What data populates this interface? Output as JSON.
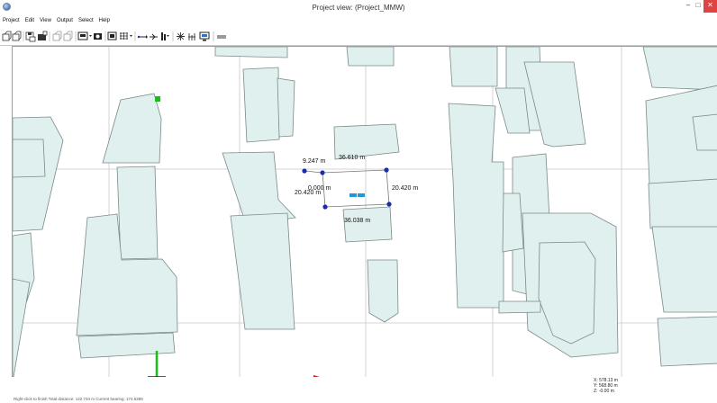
{
  "window": {
    "title": "Project view: (Project_MMW)",
    "minimize_glyph": "–",
    "maximize_glyph": "□",
    "close_glyph": "✕"
  },
  "menu": {
    "items": [
      "Project",
      "Edit",
      "View",
      "Output",
      "Select",
      "Help"
    ]
  },
  "toolbar": {
    "icons": [
      "new-project-icon",
      "open-project-icon",
      "save-icon",
      "export-icon",
      "copy-icon",
      "paste-icon",
      "display-mode-icon",
      "camera-icon",
      "layers-icon",
      "grid-icon",
      "measure-icon",
      "link-icon",
      "antenna-icon",
      "route-icon",
      "sun-icon",
      "calculate-icon",
      "monitor-icon",
      "ruler-icon"
    ]
  },
  "map": {
    "dimensions": [
      "9.247  m",
      "36.610  m",
      "0.000  m",
      "20.420  m",
      "20.420  m",
      "36.038  m"
    ]
  },
  "coords": {
    "x": "X: 578.13 m",
    "y": "Y: 568.80 m",
    "z": "Z: -0.00 m"
  },
  "status": {
    "text": "Right-click to finish  Total distance: 122.734 m  Current bearing: 174.6289"
  },
  "colors": {
    "building_fill": "#dff0ee",
    "building_stroke": "#7a8a89",
    "grid_line": "#c8c8c8",
    "marker_blue": "#1a2bb0",
    "marker_cyan": "#1e9ad6",
    "marker_green": "#17c017",
    "close_red": "#e04343"
  }
}
